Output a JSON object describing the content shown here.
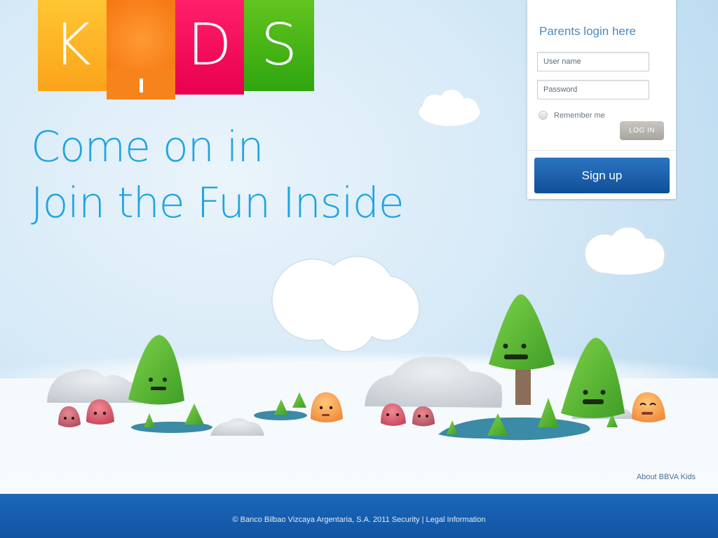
{
  "logo": {
    "letters": [
      "K",
      "D",
      "S"
    ]
  },
  "headline": {
    "line1": "Come on in",
    "line2": "Join the Fun Inside"
  },
  "login": {
    "title": "Parents login here",
    "username_placeholder": "User name",
    "password_placeholder": "Password",
    "remember_label": "Remember me",
    "login_button": "LOG IN",
    "signup_button": "Sign up"
  },
  "links": {
    "about": "About BBVA Kids"
  },
  "footer": {
    "copyright": "© Banco Bilbao Vizcaya Argentaria, S.A. 2011",
    "security": "Security",
    "separator": "|",
    "legal": "Legal Information"
  },
  "colors": {
    "tile_k": "#fbb022",
    "tile_i": "#f77d18",
    "tile_d": "#f4005b",
    "tile_s": "#49b517",
    "headline": "#1ea4e1",
    "signup": "#1a5ea9",
    "footer": "#1a62b2"
  }
}
